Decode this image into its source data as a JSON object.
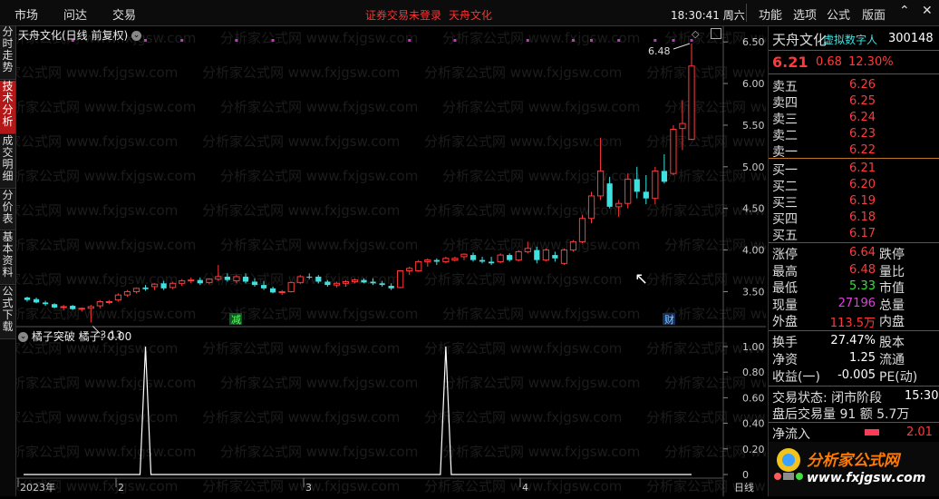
{
  "topbar": {
    "menus": [
      "市场",
      "问达",
      "交易"
    ],
    "status_msg": "证券交易未登录",
    "stock_name": "天舟文化",
    "clock": "18:30:41 周六",
    "right_menus": [
      "功能",
      "选项",
      "公式",
      "版面"
    ]
  },
  "left_tabs": [
    "分时走势",
    "技术分析",
    "成交明细",
    "分价表",
    "基本资料",
    "公式下载"
  ],
  "watermark": "分析家公式网 www.fxjgsw.com",
  "chart": {
    "title": "天舟文化(日线 前复权)",
    "y_axis_labels": [
      "6.50",
      "6.00",
      "5.50",
      "5.00",
      "4.50",
      "4.00",
      "3.50"
    ],
    "high_marker": "6.48",
    "low_marker": "3.13",
    "event_labels": [
      "减",
      "财"
    ],
    "indicator_title": "橘子突破",
    "indicator_value_label": "橘子: 0.00",
    "indicator_axis_labels": [
      "1.00",
      "0.80",
      "0.60",
      "0.40",
      "0.20",
      "0"
    ],
    "x_axis_labels": [
      "2023年",
      "2",
      "3",
      "4"
    ],
    "x_axis_cut": "日线",
    "colors": {
      "up": "#ff3a3a",
      "down": "#40e0e0",
      "purple_dot": "#d030d0"
    }
  },
  "chart_data": {
    "type": "candlestick",
    "title": "天舟文化(日线 前复权)",
    "ylim": [
      3.2,
      6.6
    ],
    "candles": [
      [
        3.43,
        3.44,
        3.38,
        3.4
      ],
      [
        3.41,
        3.43,
        3.36,
        3.37
      ],
      [
        3.37,
        3.39,
        3.33,
        3.35
      ],
      [
        3.35,
        3.36,
        3.3,
        3.31
      ],
      [
        3.31,
        3.34,
        3.28,
        3.32
      ],
      [
        3.33,
        3.34,
        3.28,
        3.29
      ],
      [
        3.29,
        3.31,
        3.26,
        3.3
      ],
      [
        3.3,
        3.34,
        3.13,
        3.32
      ],
      [
        3.33,
        3.4,
        3.3,
        3.38
      ],
      [
        3.38,
        3.4,
        3.35,
        3.38
      ],
      [
        3.4,
        3.48,
        3.38,
        3.46
      ],
      [
        3.46,
        3.52,
        3.44,
        3.5
      ],
      [
        3.5,
        3.55,
        3.48,
        3.54
      ],
      [
        3.55,
        3.58,
        3.51,
        3.53
      ],
      [
        3.56,
        3.6,
        3.52,
        3.59
      ],
      [
        3.6,
        3.63,
        3.52,
        3.54
      ],
      [
        3.55,
        3.62,
        3.53,
        3.6
      ],
      [
        3.6,
        3.65,
        3.57,
        3.63
      ],
      [
        3.63,
        3.67,
        3.6,
        3.64
      ],
      [
        3.64,
        3.67,
        3.58,
        3.6
      ],
      [
        3.61,
        3.66,
        3.59,
        3.65
      ],
      [
        3.65,
        3.82,
        3.63,
        3.68
      ],
      [
        3.68,
        3.72,
        3.62,
        3.64
      ],
      [
        3.63,
        3.7,
        3.6,
        3.68
      ],
      [
        3.68,
        3.72,
        3.6,
        3.62
      ],
      [
        3.62,
        3.66,
        3.56,
        3.58
      ],
      [
        3.58,
        3.63,
        3.52,
        3.54
      ],
      [
        3.54,
        3.56,
        3.48,
        3.49
      ],
      [
        3.49,
        3.52,
        3.46,
        3.5
      ],
      [
        3.5,
        3.62,
        3.49,
        3.61
      ],
      [
        3.61,
        3.7,
        3.59,
        3.68
      ],
      [
        3.68,
        3.72,
        3.65,
        3.67
      ],
      [
        3.68,
        3.7,
        3.6,
        3.62
      ],
      [
        3.62,
        3.64,
        3.56,
        3.58
      ],
      [
        3.58,
        3.62,
        3.55,
        3.6
      ],
      [
        3.6,
        3.64,
        3.56,
        3.62
      ],
      [
        3.62,
        3.66,
        3.6,
        3.64
      ],
      [
        3.64,
        3.66,
        3.6,
        3.61
      ],
      [
        3.62,
        3.66,
        3.58,
        3.6
      ],
      [
        3.6,
        3.63,
        3.56,
        3.58
      ],
      [
        3.57,
        3.6,
        3.52,
        3.54
      ],
      [
        3.55,
        3.76,
        3.54,
        3.75
      ],
      [
        3.75,
        3.8,
        3.7,
        3.78
      ],
      [
        3.75,
        3.88,
        3.74,
        3.86
      ],
      [
        3.86,
        3.9,
        3.8,
        3.88
      ],
      [
        3.88,
        3.9,
        3.82,
        3.86
      ],
      [
        3.86,
        3.92,
        3.84,
        3.9
      ],
      [
        3.88,
        3.92,
        3.86,
        3.9
      ],
      [
        3.92,
        3.96,
        3.88,
        3.95
      ],
      [
        3.94,
        3.97,
        3.86,
        3.88
      ],
      [
        3.88,
        3.92,
        3.84,
        3.86
      ],
      [
        3.86,
        3.92,
        3.82,
        3.84
      ],
      [
        3.86,
        3.96,
        3.84,
        3.94
      ],
      [
        3.94,
        3.96,
        3.86,
        3.88
      ],
      [
        3.88,
        4.0,
        3.86,
        3.98
      ],
      [
        3.98,
        4.1,
        3.96,
        4.02
      ],
      [
        4.0,
        4.04,
        3.84,
        3.88
      ],
      [
        3.88,
        4.02,
        3.86,
        4.0
      ],
      [
        3.94,
        3.98,
        3.86,
        3.9
      ],
      [
        3.84,
        4.02,
        3.82,
        4.0
      ],
      [
        4.0,
        4.12,
        3.98,
        4.1
      ],
      [
        4.1,
        4.42,
        4.08,
        4.38
      ],
      [
        4.38,
        4.7,
        4.32,
        4.65
      ],
      [
        4.65,
        5.35,
        4.6,
        4.95
      ],
      [
        4.8,
        4.88,
        4.5,
        4.52
      ],
      [
        4.52,
        4.6,
        4.4,
        4.56
      ],
      [
        4.56,
        4.92,
        4.5,
        4.85
      ],
      [
        4.85,
        5.0,
        4.62,
        4.7
      ],
      [
        4.7,
        4.9,
        4.55,
        4.62
      ],
      [
        4.62,
        5.0,
        4.55,
        4.95
      ],
      [
        4.95,
        5.15,
        4.8,
        4.82
      ],
      [
        4.92,
        5.5,
        4.9,
        5.45
      ],
      [
        5.46,
        5.8,
        5.2,
        5.52
      ],
      [
        5.33,
        6.48,
        5.32,
        6.21
      ]
    ],
    "indicator": {
      "name": "橘子突破",
      "ylim": [
        0,
        1
      ],
      "spikes_at_index": [
        13,
        46
      ]
    }
  },
  "quote": {
    "name": "天舟文化",
    "tag": "虚拟数字人",
    "code": "300148",
    "price": "6.21",
    "change": "0.68",
    "change_pct": "12.30%",
    "asks": [
      {
        "label": "卖五",
        "price": "6.26"
      },
      {
        "label": "卖四",
        "price": "6.25"
      },
      {
        "label": "卖三",
        "price": "6.24"
      },
      {
        "label": "卖二",
        "price": "6.23"
      },
      {
        "label": "卖一",
        "price": "6.22"
      }
    ],
    "bids": [
      {
        "label": "买一",
        "price": "6.21"
      },
      {
        "label": "买二",
        "price": "6.20"
      },
      {
        "label": "买三",
        "price": "6.19"
      },
      {
        "label": "买四",
        "price": "6.18"
      },
      {
        "label": "买五",
        "price": "6.17"
      }
    ],
    "stats": [
      {
        "label": "涨停",
        "value": "6.64",
        "label2": "跌停",
        "cls": "red"
      },
      {
        "label": "最高",
        "value": "6.48",
        "label2": "量比",
        "cls": "red"
      },
      {
        "label": "最低",
        "value": "5.33",
        "label2": "市值",
        "cls": "grn"
      },
      {
        "label": "现量",
        "value": "27196",
        "label2": "总量",
        "cls": "mag"
      },
      {
        "label": "外盘",
        "value": "113.5万",
        "label2": "内盘",
        "cls": "red"
      }
    ],
    "fin": [
      {
        "label": "换手",
        "value": "27.47%",
        "label2": "股本"
      },
      {
        "label": "净资",
        "value": "1.25",
        "label2": "流通"
      },
      {
        "label": "收益(一)",
        "value": "-0.005",
        "label2": "PE(动)"
      }
    ],
    "trade_state_label": "交易状态: 闭市阶段",
    "trade_state_time": "15:30",
    "after_hours": "盘后交易量 91 额 5.7万",
    "net_inflow_label": "净流入",
    "net_inflow_value": "2.01",
    "brand_name": "分析家公式网",
    "brand_url": "www.fxjgsw.com"
  }
}
